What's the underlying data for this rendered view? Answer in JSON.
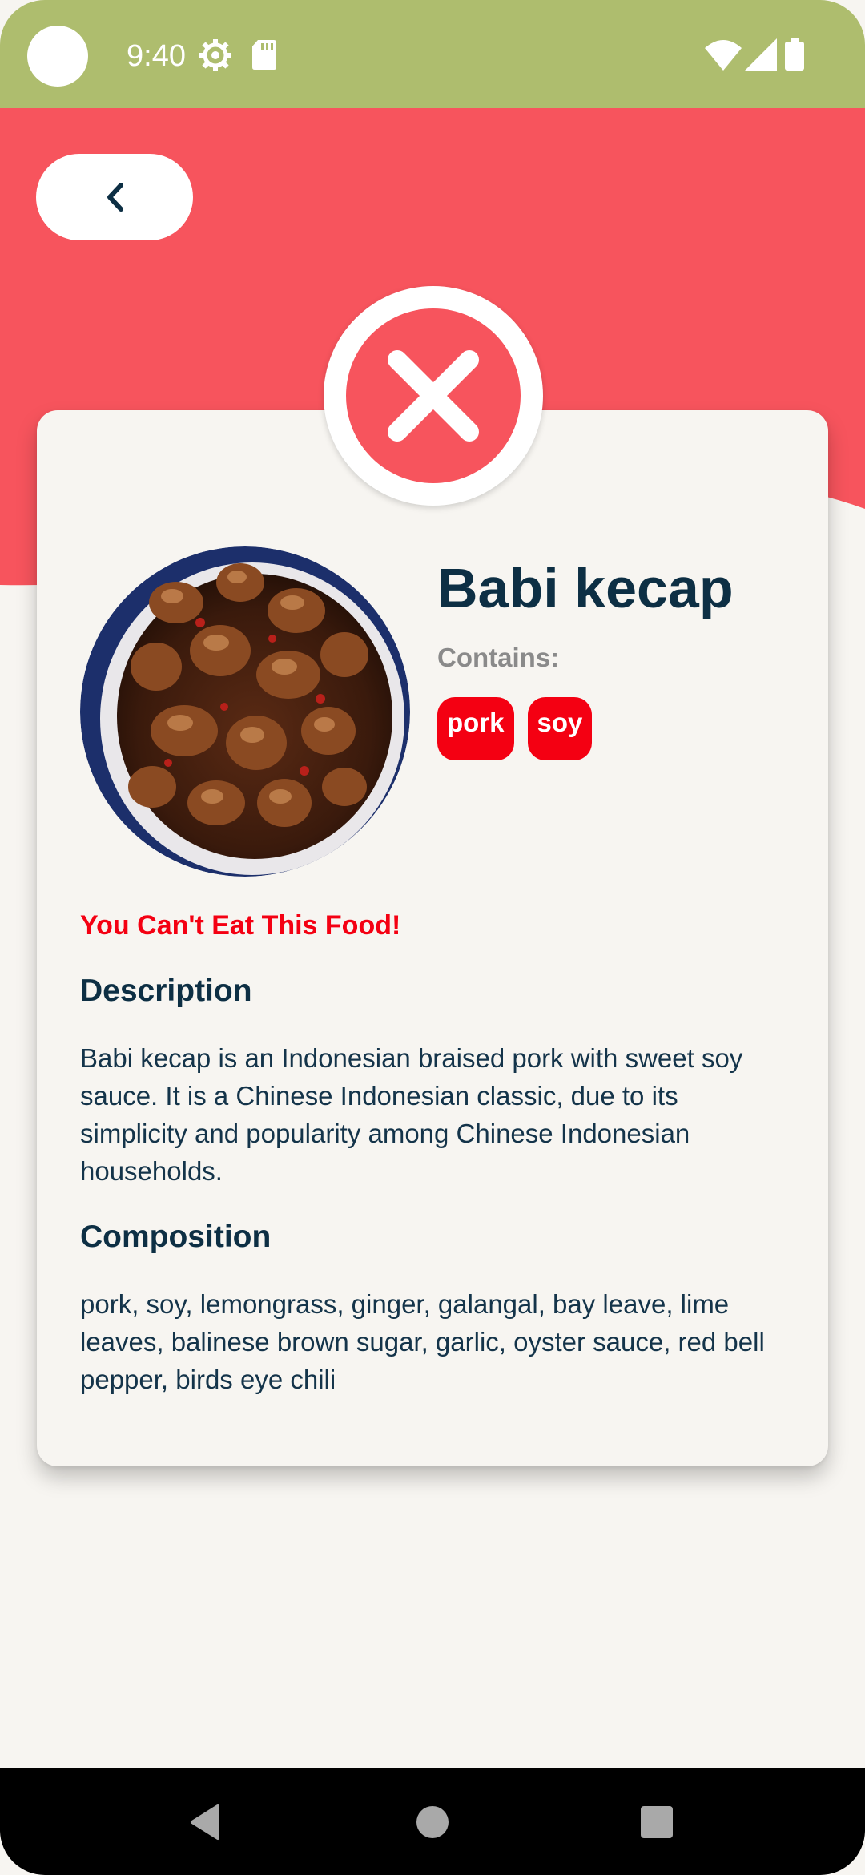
{
  "status_bar": {
    "time": "9:40",
    "icons": [
      "gear-icon",
      "sd-card-icon",
      "wifi-icon",
      "signal-icon",
      "battery-icon"
    ],
    "background": "#aebd6e"
  },
  "header": {
    "back_icon": "chevron-left-icon",
    "background": "#f7545d"
  },
  "result": {
    "status_icon": "close-icon",
    "status_color": "#f7545d"
  },
  "food": {
    "name": "Babi kecap",
    "contains_label": "Contains:",
    "allergens": [
      "pork",
      "soy"
    ],
    "allergen_color": "#f40012",
    "warning": "You Can't Eat This Food!",
    "description_heading": "Description",
    "description": "Babi kecap is an Indonesian braised pork with sweet soy sauce. It is a Chinese Indonesian classic, due to its simplicity and popularity among Chinese Indonesian households.",
    "composition_heading": "Composition",
    "composition": "pork, soy, lemongrass, ginger, galangal, bay leave, lime leaves, balinese brown sugar, garlic, oyster sauce, red bell pepper, birds eye chili"
  },
  "nav_bar": {
    "buttons": [
      "back-triangle-icon",
      "home-circle-icon",
      "recents-square-icon"
    ]
  }
}
